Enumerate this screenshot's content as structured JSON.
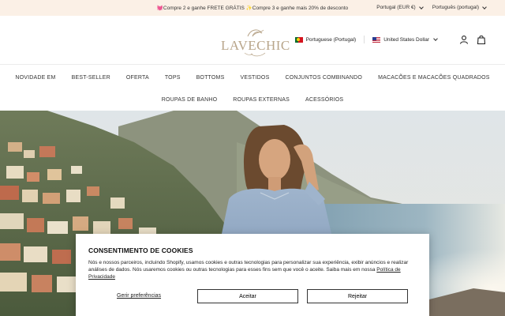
{
  "announcement": {
    "heart": "💓",
    "part1": "Compre 2 e ganhe FRETE GRÁTIS ",
    "sparkle": "✨",
    "part2": "Compre 3 e ganhe mais 20% de desconto"
  },
  "topbar": {
    "currency": "Portugal (EUR €)",
    "language": "Português (portugal)"
  },
  "brand": {
    "logo": "LAVECHIC"
  },
  "header": {
    "language_selector": "Portuguese (Portugal)",
    "currency_selector": "United States Dollar"
  },
  "nav": {
    "row1": [
      "NOVIDADE EM",
      "BEST-SELLER",
      "OFERTA",
      "TOPS",
      "BOTTOMS",
      "VESTIDOS",
      "CONJUNTOS COMBINANDO",
      "MACACÕES E MACACÕES QUADRADOS"
    ],
    "row2": [
      "ROUPAS DE BANHO",
      "ROUPAS EXTERNAS",
      "ACESSÓRIOS"
    ]
  },
  "cookie": {
    "title": "CONSENTIMENTO DE COOKIES",
    "text": "Nós e nossos parceiros, incluindo Shopify, usamos cookies e outras tecnologias para personalizar sua experiência, exibir anúncios e realizar análises de dados. Nós usaremos cookies ou outras tecnologias para esses fins sem que você o aceite. Saiba mais em nossa ",
    "policy_link": "Política de Privacidade",
    "manage": "Gerir preferências",
    "accept": "Aceitar",
    "reject": "Rejeitar"
  },
  "icons": {
    "account": "user-icon",
    "cart": "bag-icon",
    "chevron": "chevron-down-icon"
  },
  "colors": {
    "topbar_bg": "#fbf0e6",
    "logo": "#b8a58a",
    "sea": "#7fa3b8",
    "dress": "#8fa7c4"
  }
}
